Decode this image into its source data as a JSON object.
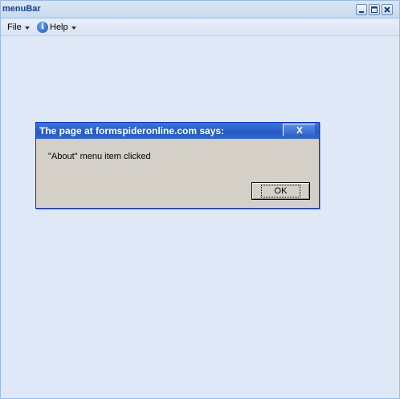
{
  "window": {
    "title": "menuBar"
  },
  "menubar": {
    "file_label": "File",
    "help_label": "Help",
    "help_icon_glyph": "i"
  },
  "dialog": {
    "title": "The page at formspideronline.com says:",
    "message": "\"About\" menu item clicked",
    "ok_label": "OK"
  },
  "icons": {
    "minimize": "minimize-icon",
    "maximize": "maximize-icon",
    "close": "close-icon",
    "help": "info-icon",
    "dropdown": "dropdown-arrow-icon"
  },
  "colors": {
    "window_bg": "#dfe8f6",
    "title_text": "#15428b",
    "dialog_title_bg": "#2558c4",
    "dialog_bg": "#d4d0c8"
  }
}
